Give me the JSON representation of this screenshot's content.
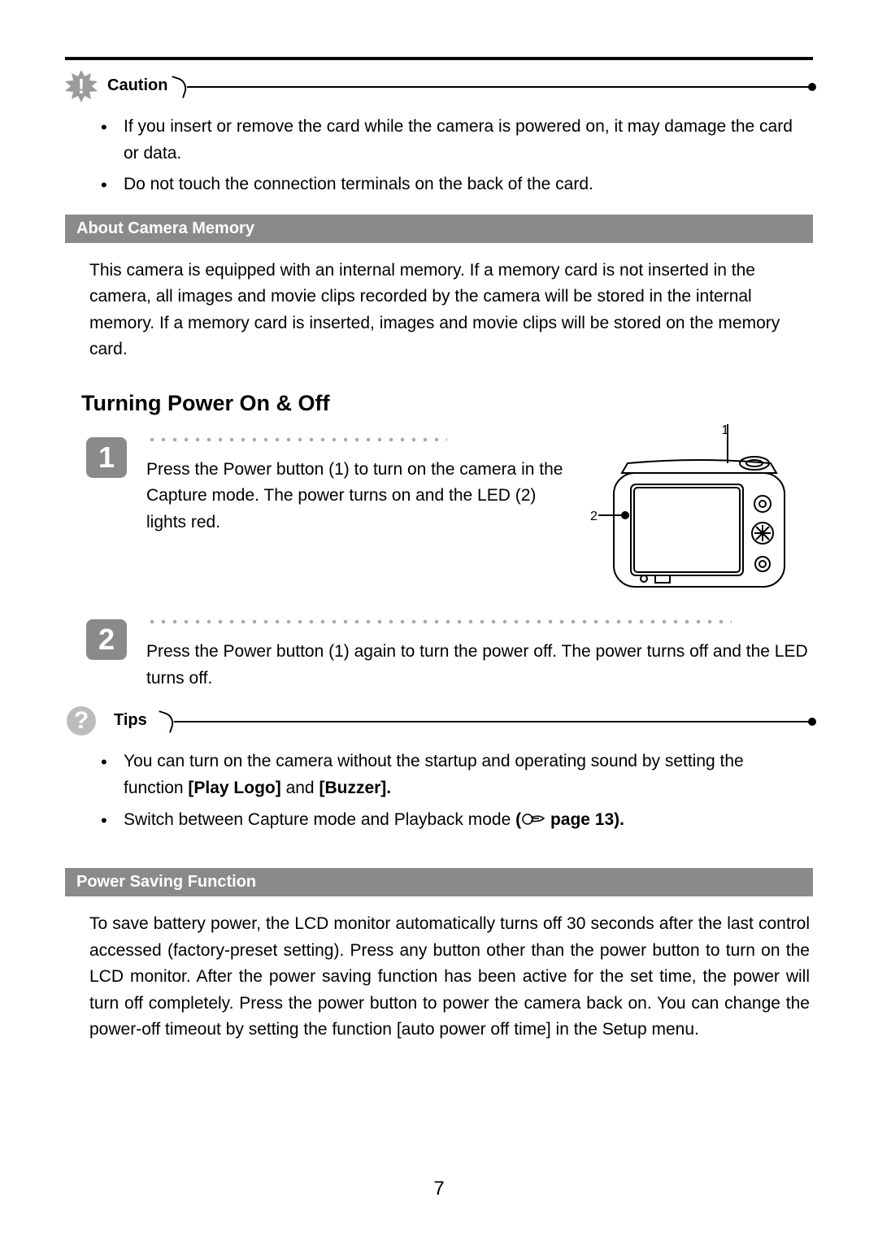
{
  "caution": {
    "label": "Caution",
    "bullets": [
      "If you insert or remove the card while the camera is powered on, it may damage the card or data.",
      "Do not touch the connection terminals on the back of the card."
    ]
  },
  "about_memory": {
    "title": "About Camera Memory",
    "text": "This camera is equipped with an internal memory. If a memory card is not inserted in the camera, all images and movie clips recorded by the camera will be stored in the internal memory. If a memory card is inserted, images and movie clips will be stored on the memory card."
  },
  "power_heading": "Turning Power On & Off",
  "steps": {
    "s1": {
      "num": "1",
      "text": "Press the Power button (1) to turn on the camera in the Capture mode. The power turns on and the LED (2) lights red.",
      "callout1": "1",
      "callout2": "2"
    },
    "s2": {
      "num": "2",
      "text": "Press the Power button (1) again to turn the power off. The power turns off and the LED turns off."
    }
  },
  "tips": {
    "label": "Tips",
    "bullet1_a": "You can turn on the camera without the startup and operating sound by setting the function ",
    "bullet1_b": "[Play Logo]",
    "bullet1_c": " and ",
    "bullet1_d": "[Buzzer].",
    "bullet2_a": "Switch between Capture mode and Playback mode ",
    "bullet2_b": "(",
    "bullet2_c": "  page 13)."
  },
  "power_saving": {
    "title": "Power Saving Function",
    "text": "To save battery power, the LCD monitor automatically turns off 30 seconds after the last control accessed (factory-preset setting). Press any button other than the power button to turn on the LCD monitor. After the power saving function has been active for the set time, the power will turn off completely. Press the power button to power the camera back on. You can change the power-off timeout by setting the function [auto power off time] in the Setup menu."
  },
  "page_number": "7"
}
